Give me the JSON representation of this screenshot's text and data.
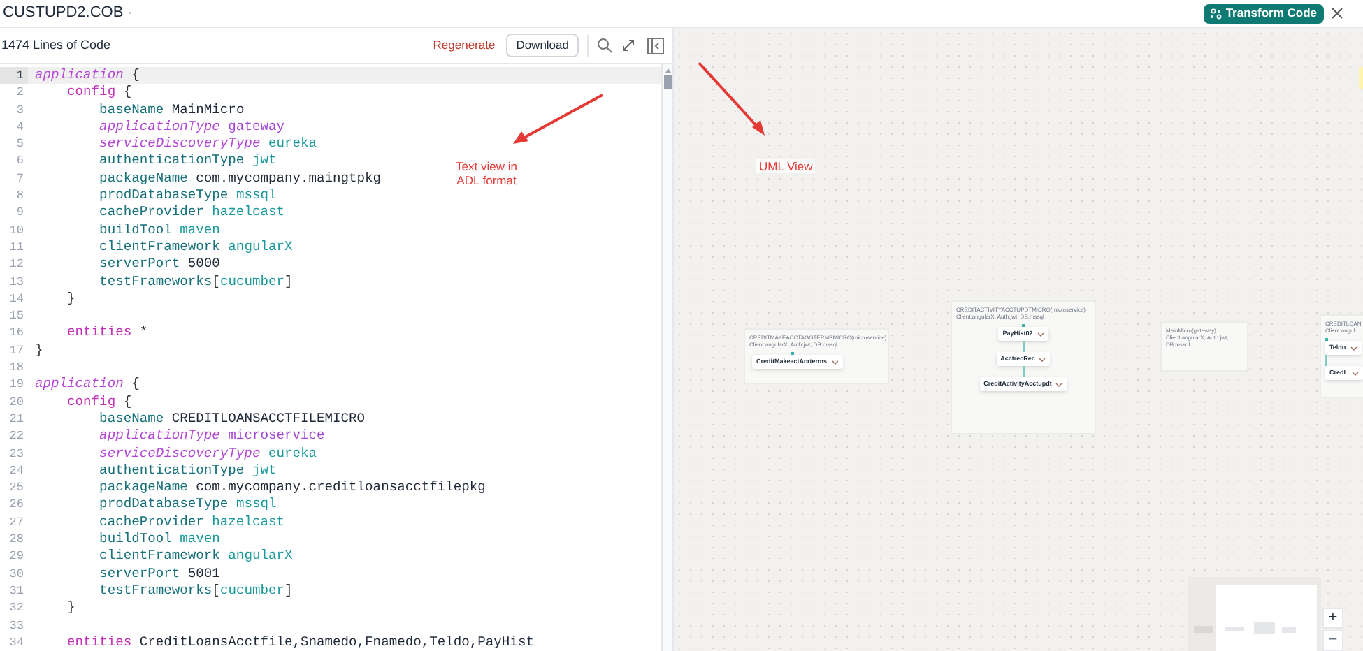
{
  "header": {
    "title": "CUSTUPD2.COB",
    "title_suffix": "·",
    "transform_button": "Transform Code"
  },
  "editor": {
    "line_count": "1474 Lines of Code",
    "regenerate": "Regenerate",
    "download": "Download",
    "lines": [
      {
        "number": "1",
        "active": true,
        "tokens": [
          {
            "kind": "keyword",
            "text": "application"
          },
          {
            "kind": "punct",
            "text": " {"
          }
        ]
      },
      {
        "number": "2",
        "active": false,
        "tokens": [
          {
            "kind": "block",
            "text": "    config"
          },
          {
            "kind": "punct",
            "text": " {"
          }
        ]
      },
      {
        "number": "3",
        "active": false,
        "tokens": [
          {
            "kind": "property",
            "text": "        baseName"
          },
          {
            "kind": "value",
            "text": " MainMicro"
          }
        ]
      },
      {
        "number": "4",
        "active": false,
        "tokens": [
          {
            "kind": "keyword",
            "text": "        applicationType"
          },
          {
            "kind": "special",
            "text": " gateway"
          }
        ]
      },
      {
        "number": "5",
        "active": false,
        "tokens": [
          {
            "kind": "keyword",
            "text": "        serviceDiscoveryType"
          },
          {
            "kind": "literal",
            "text": " eureka"
          }
        ]
      },
      {
        "number": "6",
        "active": false,
        "tokens": [
          {
            "kind": "property",
            "text": "        authenticationType"
          },
          {
            "kind": "literal",
            "text": " jwt"
          }
        ]
      },
      {
        "number": "7",
        "active": false,
        "tokens": [
          {
            "kind": "property",
            "text": "        packageName"
          },
          {
            "kind": "value",
            "text": " com.mycompany.maingtpkg"
          }
        ]
      },
      {
        "number": "8",
        "active": false,
        "tokens": [
          {
            "kind": "property",
            "text": "        prodDatabaseType"
          },
          {
            "kind": "literal",
            "text": " mssql"
          }
        ]
      },
      {
        "number": "9",
        "active": false,
        "tokens": [
          {
            "kind": "property",
            "text": "        cacheProvider"
          },
          {
            "kind": "literal",
            "text": " hazelcast"
          }
        ]
      },
      {
        "number": "10",
        "active": false,
        "tokens": [
          {
            "kind": "property",
            "text": "        buildTool"
          },
          {
            "kind": "literal",
            "text": " maven"
          }
        ]
      },
      {
        "number": "11",
        "active": false,
        "tokens": [
          {
            "kind": "property",
            "text": "        clientFramework"
          },
          {
            "kind": "literal",
            "text": " angularX"
          }
        ]
      },
      {
        "number": "12",
        "active": false,
        "tokens": [
          {
            "kind": "property",
            "text": "        serverPort"
          },
          {
            "kind": "value",
            "text": " 5000"
          }
        ]
      },
      {
        "number": "13",
        "active": false,
        "tokens": [
          {
            "kind": "property",
            "text": "        testFrameworks"
          },
          {
            "kind": "punct",
            "text": "["
          },
          {
            "kind": "literal",
            "text": "cucumber"
          },
          {
            "kind": "punct",
            "text": "]"
          }
        ]
      },
      {
        "number": "14",
        "active": false,
        "tokens": [
          {
            "kind": "punct",
            "text": "    }"
          }
        ]
      },
      {
        "number": "15",
        "active": false
      },
      {
        "number": "16",
        "active": false,
        "tokens": [
          {
            "kind": "block",
            "text": "    entities"
          },
          {
            "kind": "value",
            "text": " *"
          }
        ]
      },
      {
        "number": "17",
        "active": false,
        "tokens": [
          {
            "kind": "punct",
            "text": "}"
          }
        ]
      },
      {
        "number": "18",
        "active": false
      },
      {
        "number": "19",
        "active": false,
        "tokens": [
          {
            "kind": "keyword",
            "text": "application"
          },
          {
            "kind": "punct",
            "text": " {"
          }
        ]
      },
      {
        "number": "20",
        "active": false,
        "tokens": [
          {
            "kind": "block",
            "text": "    config"
          },
          {
            "kind": "punct",
            "text": " {"
          }
        ]
      },
      {
        "number": "21",
        "active": false,
        "tokens": [
          {
            "kind": "property",
            "text": "        baseName"
          },
          {
            "kind": "value",
            "text": " CREDITLOANSACCTFILEMICRO"
          }
        ]
      },
      {
        "number": "22",
        "active": false,
        "tokens": [
          {
            "kind": "keyword",
            "text": "        applicationType"
          },
          {
            "kind": "special",
            "text": " microservice"
          }
        ]
      },
      {
        "number": "23",
        "active": false,
        "tokens": [
          {
            "kind": "keyword",
            "text": "        serviceDiscoveryType"
          },
          {
            "kind": "literal",
            "text": " eureka"
          }
        ]
      },
      {
        "number": "24",
        "active": false,
        "tokens": [
          {
            "kind": "property",
            "text": "        authenticationType"
          },
          {
            "kind": "literal",
            "text": " jwt"
          }
        ]
      },
      {
        "number": "25",
        "active": false,
        "tokens": [
          {
            "kind": "property",
            "text": "        packageName"
          },
          {
            "kind": "value",
            "text": " com.mycompany.creditloansacctfilepkg"
          }
        ]
      },
      {
        "number": "26",
        "active": false,
        "tokens": [
          {
            "kind": "property",
            "text": "        prodDatabaseType"
          },
          {
            "kind": "literal",
            "text": " mssql"
          }
        ]
      },
      {
        "number": "27",
        "active": false,
        "tokens": [
          {
            "kind": "property",
            "text": "        cacheProvider"
          },
          {
            "kind": "literal",
            "text": " hazelcast"
          }
        ]
      },
      {
        "number": "28",
        "active": false,
        "tokens": [
          {
            "kind": "property",
            "text": "        buildTool"
          },
          {
            "kind": "literal",
            "text": " maven"
          }
        ]
      },
      {
        "number": "29",
        "active": false,
        "tokens": [
          {
            "kind": "property",
            "text": "        clientFramework"
          },
          {
            "kind": "literal",
            "text": " angularX"
          }
        ]
      },
      {
        "number": "30",
        "active": false,
        "tokens": [
          {
            "kind": "property",
            "text": "        serverPort"
          },
          {
            "kind": "value",
            "text": " 5001"
          }
        ]
      },
      {
        "number": "31",
        "active": false,
        "tokens": [
          {
            "kind": "property",
            "text": "        testFrameworks"
          },
          {
            "kind": "punct",
            "text": "["
          },
          {
            "kind": "literal",
            "text": "cucumber"
          },
          {
            "kind": "punct",
            "text": "]"
          }
        ]
      },
      {
        "number": "32",
        "active": false,
        "tokens": [
          {
            "kind": "punct",
            "text": "    }"
          }
        ]
      },
      {
        "number": "33",
        "active": false
      },
      {
        "number": "34",
        "active": false,
        "tokens": [
          {
            "kind": "block",
            "text": "    entities"
          },
          {
            "kind": "value",
            "text": " CreditLoansAcctfile,Snamedo,Fnamedo,Teldo,PayHist"
          }
        ]
      }
    ]
  },
  "annotations": [
    {
      "text": "Text view in ADL format"
    },
    {
      "text": "UML View"
    }
  ],
  "canvas": {
    "groups": [
      {
        "title": "CREDITMAKEACCTAGGTERMSMICRO(microservice)",
        "subtitle": "Client:angularX, Auth:jwt, DB:mssql",
        "entities": [
          "CreditMakeactAcrterms"
        ]
      },
      {
        "title": "CREDITACTIVITYACCTUPDTMICRO(microservice)",
        "subtitle": "Client:angularX, Auth:jwt, DB:mssql",
        "entities": [
          "PayHist02",
          "AcctrecRec",
          "CreditActivityAcctupdt"
        ]
      },
      {
        "title": "MainMicro(gateway)",
        "subtitle": "Client:angularX, Auth:jwt, DB:mssql"
      },
      {
        "title": "CREDITLOAN",
        "subtitle": "Client:angul",
        "entities": [
          "Teldo",
          "CredL"
        ]
      }
    ],
    "zoom_in": "+",
    "zoom_out": "−"
  }
}
